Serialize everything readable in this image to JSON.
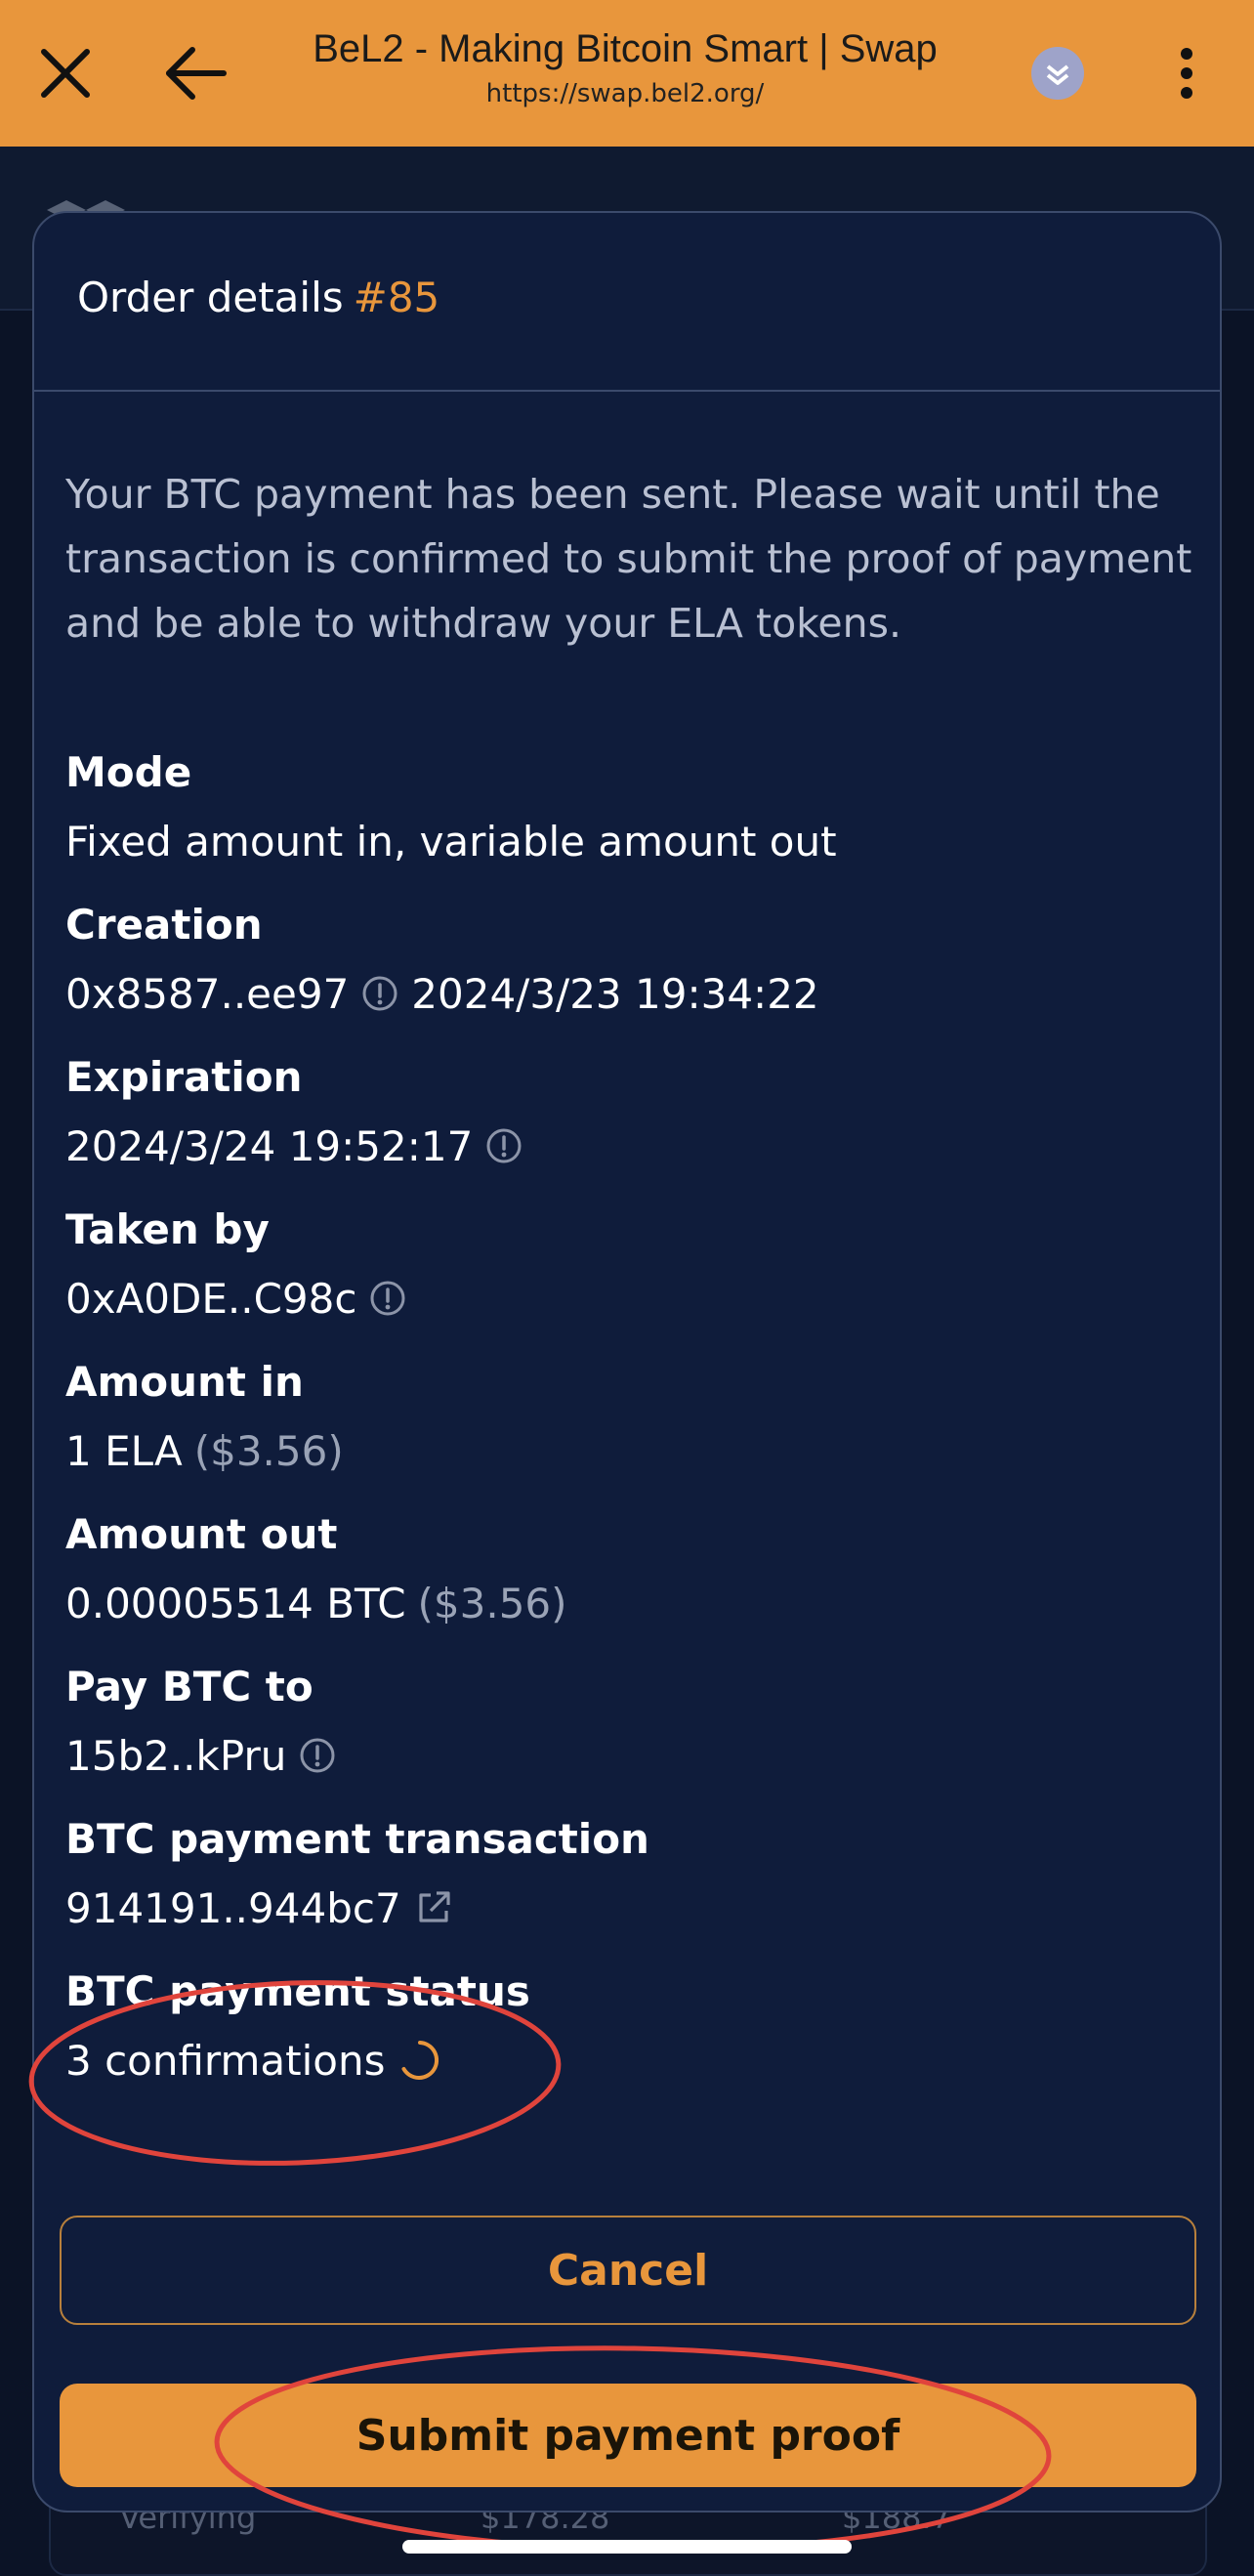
{
  "browser": {
    "title": "BeL2 - Making Bitcoin Smart | Swap",
    "url": "https://swap.bel2.org/",
    "close_icon": "close-icon",
    "back_icon": "back-arrow-icon",
    "extension_icon": "extension-icon",
    "menu_icon": "more-vert-icon",
    "accent_color": "#e8963c"
  },
  "background": {
    "row_left": "Verifying",
    "row_mid": "$178.28",
    "row_right": "$188.7"
  },
  "modal": {
    "title": "Order details",
    "order_number": "#85",
    "notice": "Your BTC payment has been sent. Please wait until the transaction is confirmed to submit the proof of payment and be able to withdraw your ELA tokens.",
    "fields": {
      "mode": {
        "label": "Mode",
        "value": "Fixed amount in, variable amount out"
      },
      "creation": {
        "label": "Creation",
        "address": "0x8587..ee97",
        "date": "2024/3/23 19:34:22"
      },
      "expiration": {
        "label": "Expiration",
        "date": "2024/3/24 19:52:17"
      },
      "taken_by": {
        "label": "Taken by",
        "address": "0xA0DE..C98c"
      },
      "amount_in": {
        "label": "Amount in",
        "value": "1 ELA",
        "usd": "($3.56)"
      },
      "amount_out": {
        "label": "Amount out",
        "value": "0.00005514 BTC",
        "usd": "($3.56)"
      },
      "pay_btc_to": {
        "label": "Pay BTC to",
        "address": "15b2..kPru"
      },
      "btc_tx": {
        "label": "BTC payment transaction",
        "value": "914191..944bc7"
      },
      "btc_status": {
        "label": "BTC payment status",
        "value": "3 confirmations"
      }
    },
    "buttons": {
      "cancel": "Cancel",
      "submit": "Submit payment proof"
    }
  },
  "colors": {
    "modal_bg": "#0f1c3b",
    "accent": "#e8963c",
    "annotation": "#e0443c"
  }
}
